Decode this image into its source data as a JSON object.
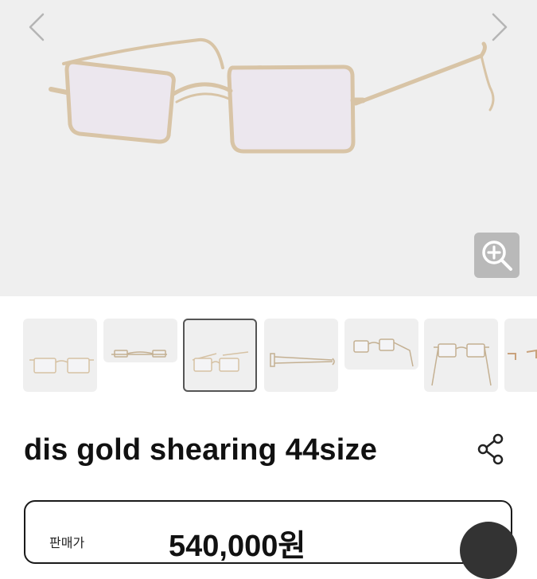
{
  "gallery": {
    "prev_icon": "chevron-left-icon",
    "next_icon": "chevron-right-icon",
    "zoom_icon": "zoom-in-icon",
    "thumbnail_count": 7,
    "active_thumbnail": 3
  },
  "product": {
    "title": "dis gold shearing 44size",
    "share_icon": "share-icon"
  },
  "price": {
    "label": "판매가",
    "value": "540,000원"
  },
  "colors": {
    "hero_background": "#efefef",
    "frame_gold": "#d6c2a4",
    "text": "#111111",
    "zoom_button": "#b9b9b9"
  }
}
